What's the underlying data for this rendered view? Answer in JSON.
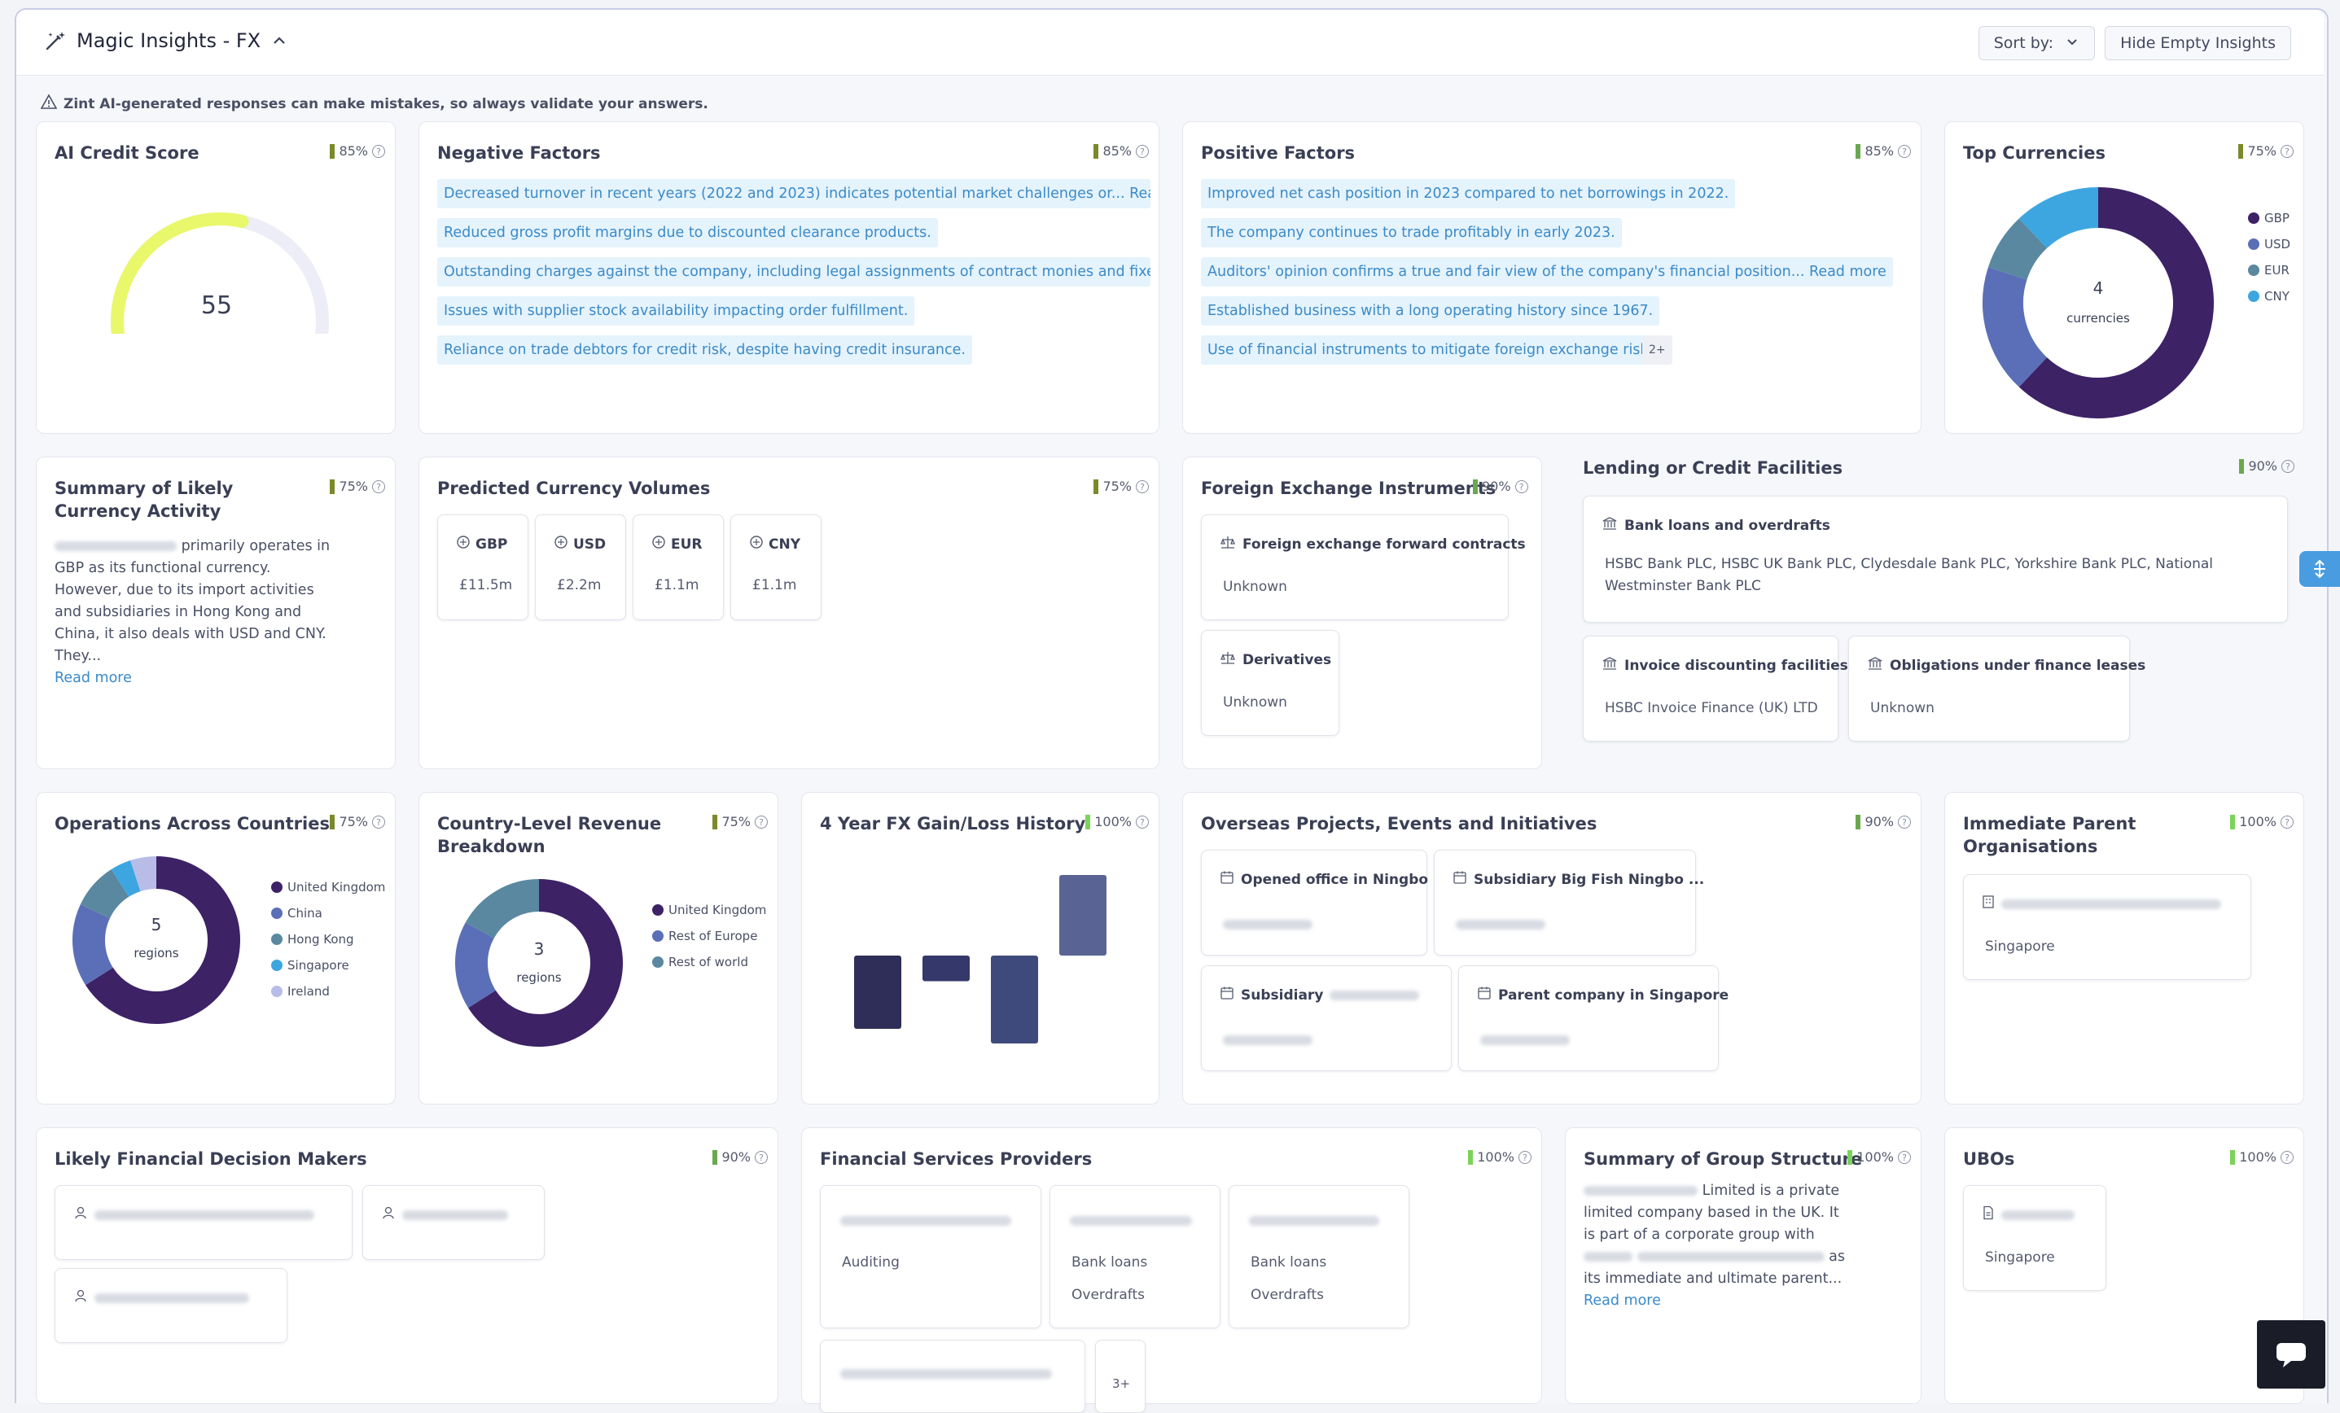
{
  "header": {
    "title": "Magic Insights - FX",
    "sort_label": "Sort by:",
    "hide_empty_label": "Hide Empty Insights"
  },
  "warning": "Zint AI-generated responses can make mistakes, so always validate your answers.",
  "colors": {
    "navy": "#3d2266",
    "blue": "#5b6fb8",
    "slate": "#5a88a0",
    "light_blue": "#3da6e0",
    "lavender": "#b8bde8",
    "gauge_fill": "#e9f76b",
    "gauge_track": "#ecedf6",
    "chip_bg": "#e5f3fc",
    "link": "#3b8ac9"
  },
  "credit_score": {
    "title": "AI Credit Score",
    "confidence": "85%",
    "score": "55",
    "score_value": 55,
    "score_max": 100
  },
  "negative": {
    "title": "Negative Factors",
    "confidence": "85%",
    "items": [
      "Decreased turnover in recent years (2022 and 2023) indicates potential market challenges or... Read more",
      "Reduced gross profit margins due to discounted clearance products.",
      "Outstanding charges against the company, including legal assignments of contract monies and fixed/floa",
      "Issues with supplier stock availability impacting order fulfillment.",
      "Reliance on trade debtors for credit risk, despite having credit insurance."
    ]
  },
  "positive": {
    "title": "Positive Factors",
    "confidence": "85%",
    "items": [
      "Improved net cash position in 2023 compared to net borrowings in 2022.",
      "The company continues to trade profitably in early 2023.",
      "Auditors' opinion confirms a true and fair view of the company's financial position... Read more",
      "Established business with a long operating history since 1967.",
      "Use of financial instruments to mitigate foreign exchange risks."
    ],
    "more": "2+"
  },
  "top_currencies": {
    "title": "Top Currencies",
    "confidence": "75%",
    "center_count": "4",
    "center_label": "currencies",
    "legend": [
      "GBP",
      "USD",
      "EUR",
      "CNY"
    ],
    "shares": [
      62,
      18,
      8,
      12
    ]
  },
  "summary_currency": {
    "title": "Summary of Likely Currency Activity",
    "confidence": "75%",
    "text1": "primarily operates in",
    "text2": "GBP as its functional currency. However, due to its import activities and subsidiaries in Hong Kong and China, it also deals with USD and CNY. They...",
    "read_more": "Read more"
  },
  "predicted_volumes": {
    "title": "Predicted Currency Volumes",
    "confidence": "75%",
    "items": [
      {
        "code": "GBP",
        "value": "£11.5m"
      },
      {
        "code": "USD",
        "value": "£2.2m"
      },
      {
        "code": "EUR",
        "value": "£1.1m"
      },
      {
        "code": "CNY",
        "value": "£1.1m"
      }
    ]
  },
  "fx_instruments": {
    "title": "Foreign Exchange Instruments",
    "confidence": "90%",
    "items": [
      {
        "label": "Foreign exchange forward contracts",
        "value": "Unknown"
      },
      {
        "label": "Derivatives",
        "value": "Unknown"
      }
    ]
  },
  "lending": {
    "title": "Lending or Credit Facilities",
    "confidence": "90%",
    "bank_loans_label": "Bank loans and overdrafts",
    "bank_loans_value": "HSBC Bank PLC, HSBC UK Bank PLC, Clydesdale Bank PLC, Yorkshire Bank PLC, National Westminster Bank PLC",
    "invoice_label": "Invoice discounting facilities",
    "invoice_value": "HSBC Invoice Finance (UK) LTD",
    "leases_label": "Obligations under finance leases",
    "leases_value": "Unknown"
  },
  "operations": {
    "title": "Operations Across Countries",
    "confidence": "75%",
    "center_count": "5",
    "center_label": "regions",
    "legend": [
      "United Kingdom",
      "China",
      "Hong Kong",
      "Singapore",
      "Ireland"
    ],
    "shares": [
      66,
      16,
      9,
      4,
      5
    ]
  },
  "country_revenue": {
    "title": "Country-Level Revenue Breakdown",
    "confidence": "75%",
    "center_count": "3",
    "center_label": "regions",
    "legend": [
      "United Kingdom",
      "Rest of Europe",
      "Rest of world"
    ],
    "shares": [
      66,
      17,
      17
    ]
  },
  "fx_history": {
    "title": "4 Year FX Gain/Loss History",
    "confidence": "100%",
    "values": [
      -1.0,
      -0.35,
      -1.2,
      1.1
    ]
  },
  "overseas": {
    "title": "Overseas Projects, Events and Initiatives",
    "confidence": "90%",
    "items": [
      {
        "label": "Opened office in Ningbo"
      },
      {
        "label": "Subsidiary Big Fish Ningbo ..."
      },
      {
        "label": "Subsidiary"
      },
      {
        "label": "Parent company in Singapore"
      }
    ]
  },
  "parent": {
    "title": "Immediate Parent Organisations",
    "confidence": "100%",
    "location": "Singapore"
  },
  "decision_makers": {
    "title": "Likely Financial Decision Makers",
    "confidence": "90%"
  },
  "fin_providers": {
    "title": "Financial Services Providers",
    "confidence": "100%",
    "items": [
      {
        "services": [
          "Auditing"
        ]
      },
      {
        "services": [
          "Bank loans",
          "Overdrafts"
        ]
      },
      {
        "services": [
          "Bank loans",
          "Overdrafts"
        ]
      }
    ],
    "more": "3+"
  },
  "group_structure": {
    "title": "Summary of Group Structure",
    "confidence": "100%",
    "text1": "Limited is a private limited company based in the UK. It is part of a corporate group with",
    "text2": "as its immediate and ultimate parent...",
    "read_more": "Read more"
  },
  "ubos": {
    "title": "UBOs",
    "confidence": "100%",
    "location": "Singapore"
  }
}
